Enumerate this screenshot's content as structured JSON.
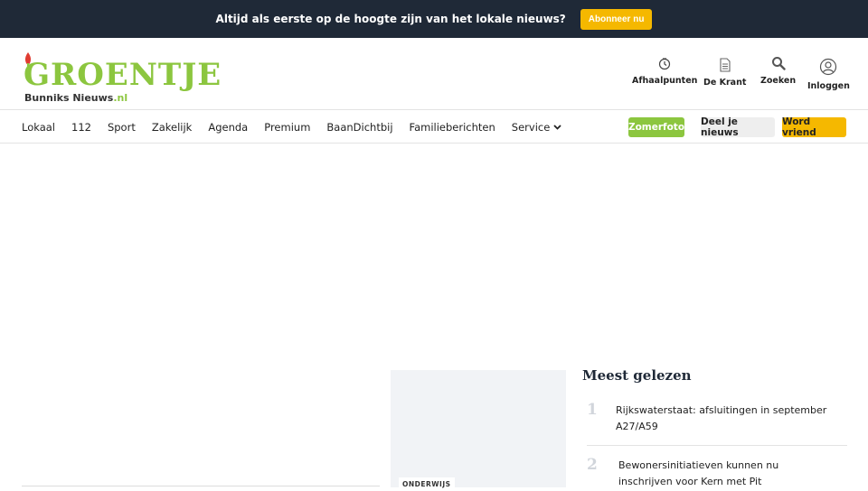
{
  "banner": {
    "text": "Altijd als eerste op de hoogte zijn van het lokale nieuws?",
    "button_label": "Abonneer nu"
  },
  "logo": {
    "main": "GROENTJE",
    "sub": "Bunniks Nieuws",
    "tld": ".nl"
  },
  "header_nav": [
    {
      "label": "Afhaalpunten",
      "icon": "clock-icon"
    },
    {
      "label": "De Krant",
      "icon": "document-icon"
    },
    {
      "label": "Zoeken",
      "icon": "search-icon"
    },
    {
      "label": "Inloggen",
      "icon": "user-icon"
    }
  ],
  "menu": [
    {
      "label": "Lokaal"
    },
    {
      "label": "112"
    },
    {
      "label": "Sport"
    },
    {
      "label": "Zakelijk"
    },
    {
      "label": "Agenda"
    },
    {
      "label": "Premium"
    },
    {
      "label": "BaanDichtbij"
    },
    {
      "label": "Familieberichten"
    },
    {
      "label": "Service",
      "icon": "chevron-down-icon"
    }
  ],
  "action_buttons": {
    "zomerfoto": "Zomerfoto",
    "deel": "Deel je nieuws",
    "vriend": "Word vriend"
  },
  "article_card": {
    "tag": "ONDERWIJS"
  },
  "most_read": {
    "title": "Meest gelezen",
    "items": [
      {
        "rank": "1",
        "title": "Rijkswaterstaat: afsluitingen in september A27/A59"
      },
      {
        "rank": "2",
        "title": "Bewonersinitiatieven kunnen nu inschrijven voor Kern met Pit"
      }
    ]
  },
  "colors": {
    "brand_green": "#8cc63f",
    "accent_yellow": "#f5b800",
    "banner_bg": "#1f2937"
  }
}
